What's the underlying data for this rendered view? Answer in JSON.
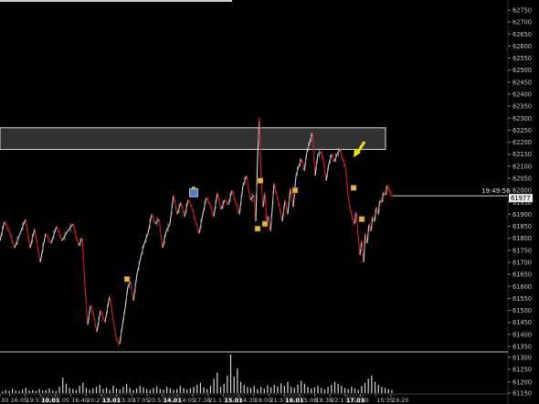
{
  "chart_data": {
    "type": "line",
    "price_axis": {
      "ticks": [
        62750,
        62700,
        62650,
        62600,
        62550,
        62500,
        62450,
        62400,
        62350,
        62300,
        62250,
        62200,
        62150,
        62100,
        62050,
        62000,
        61950,
        61900,
        61850,
        61800,
        61750,
        61700,
        61650,
        61600,
        61550,
        61500,
        61450,
        61400,
        61350
      ],
      "tick_labels": [
        "62750",
        "62700",
        "62650",
        "62600",
        "62550",
        "62500",
        "62450",
        "62400",
        "62350",
        "62300",
        "62250",
        "62200",
        "62150",
        "62100",
        "62050",
        "62000",
        "61950",
        "61900",
        "61850",
        "61800",
        "61750",
        "61700",
        "61650",
        "61600",
        "61550",
        "61500",
        "61450",
        "61400",
        "61350"
      ],
      "range": [
        61320,
        62780
      ]
    },
    "volume_axis": {
      "ticks": [
        61300,
        61250,
        61200,
        61150
      ],
      "tick_labels": [
        "61300",
        "61250",
        "61200",
        "61150"
      ]
    },
    "time_axis": {
      "labels": [
        "30",
        "16:05",
        "19:55",
        "10.01",
        "1:05",
        "16:40",
        "20:20",
        "13.01",
        "13:30",
        "17:05",
        "20:50",
        "14.01",
        "14:05",
        "17:38",
        "21:1",
        "15.01",
        "14:30",
        "18:00",
        "21:3",
        "16.01",
        "15:08",
        "18:38",
        "22:1",
        "17.01",
        "00",
        "15:35",
        "19:20"
      ],
      "highlighted": [
        "10.01",
        "13.01",
        "14.01",
        "15.01",
        "16.01",
        "17.01"
      ]
    },
    "series": [
      {
        "x": [
          0,
          5,
          10,
          16,
          22,
          28,
          33,
          38,
          44,
          50,
          56,
          62,
          68,
          74,
          80,
          86,
          90,
          93,
          96,
          99,
          102,
          106,
          110,
          115,
          120,
          124,
          128,
          131,
          134,
          137,
          140,
          143,
          146,
          150,
          154,
          158,
          162,
          166,
          170,
          174,
          178,
          182,
          186,
          190,
          194,
          198,
          202,
          206,
          210,
          214,
          218,
          222,
          226,
          230,
          234,
          238,
          242,
          246,
          250,
          254,
          258,
          262,
          266,
          270,
          274,
          278,
          280,
          282,
          284,
          286,
          288,
          290,
          292,
          294,
          296,
          298,
          300,
          303,
          306,
          309,
          312,
          315,
          318,
          321,
          324,
          327,
          330,
          333,
          336,
          339,
          342,
          345,
          348,
          351,
          354,
          357,
          360,
          363,
          366,
          369,
          372,
          375,
          378,
          381,
          384,
          386,
          388,
          390,
          392,
          394,
          396,
          398,
          400,
          402,
          404,
          406,
          408,
          410,
          412,
          414,
          416,
          418,
          420,
          422,
          424,
          426,
          428,
          430
        ],
        "y": [
          61790,
          61870,
          61830,
          61760,
          61820,
          61880,
          61760,
          61840,
          61700,
          61820,
          61780,
          61850,
          61790,
          61830,
          61860,
          61770,
          61800,
          61600,
          61440,
          61520,
          61490,
          61410,
          61500,
          61450,
          61560,
          61460,
          61370,
          61360,
          61440,
          61510,
          61600,
          61620,
          61540,
          61650,
          61720,
          61780,
          61820,
          61900,
          61860,
          61880,
          61760,
          61830,
          61860,
          61980,
          61900,
          61950,
          61890,
          61960,
          61930,
          61870,
          61820,
          61900,
          61970,
          61940,
          61890,
          61990,
          61920,
          61960,
          61940,
          62000,
          61950,
          61900,
          62020,
          62060,
          61960,
          61980,
          61870,
          62140,
          62300,
          62040,
          61930,
          61990,
          61860,
          61890,
          61830,
          61920,
          62030,
          61980,
          61930,
          61870,
          61960,
          61900,
          62010,
          61930,
          62060,
          62100,
          62130,
          62080,
          62160,
          62200,
          62240,
          62060,
          62150,
          62160,
          62130,
          62040,
          62110,
          62150,
          62120,
          62150,
          62170,
          62130,
          62100,
          61980,
          61910,
          61880,
          61860,
          61910,
          61810,
          61730,
          61790,
          61700,
          61820,
          61780,
          61860,
          61830,
          61890,
          61870,
          61930,
          61900,
          61960,
          61950,
          61990,
          61980,
          62020,
          62000,
          61980,
          61977
        ]
      }
    ],
    "volume": [
      3,
      6,
      4,
      8,
      5,
      4,
      7,
      10,
      5,
      6,
      4,
      8,
      5,
      6,
      9,
      5,
      4,
      12,
      30,
      18,
      10,
      8,
      6,
      14,
      20,
      10,
      6,
      9,
      12,
      16,
      8,
      10,
      6,
      14,
      9,
      7,
      12,
      18,
      10,
      6,
      9,
      14,
      11,
      8,
      6,
      10,
      13,
      8,
      7,
      12,
      9,
      6,
      8,
      14,
      10,
      7,
      9,
      12,
      16,
      20,
      11,
      8,
      14,
      28,
      40,
      12,
      18,
      34,
      75,
      32,
      48,
      22,
      16,
      12,
      10,
      14,
      8,
      12,
      9,
      15,
      11,
      16,
      13,
      19,
      14,
      22,
      12,
      10,
      16,
      24,
      18,
      12,
      9,
      11,
      14,
      10,
      7,
      12,
      16,
      22,
      18,
      14,
      10,
      8,
      12,
      9,
      6,
      14,
      20,
      28,
      34,
      22,
      16,
      12,
      10,
      8,
      6
    ],
    "markers": [
      {
        "x": 139,
        "y": 61630,
        "label": "s"
      },
      {
        "x": 212,
        "y": 61990,
        "label": "b"
      },
      {
        "x": 282,
        "y": 61840,
        "label": "s"
      },
      {
        "x": 285,
        "y": 62040,
        "label": "s"
      },
      {
        "x": 290,
        "y": 61860,
        "label": "s"
      },
      {
        "x": 323,
        "y": 62000,
        "label": "s"
      },
      {
        "x": 387,
        "y": 62010,
        "label": "s"
      },
      {
        "x": 396,
        "y": 61880,
        "label": "s"
      }
    ],
    "resistance_zone": [
      62170,
      62260
    ],
    "current_price_line": {
      "value": 61977,
      "price_label": "61977",
      "time_label": "19:49:56"
    },
    "arrow": {
      "color": "#f5e400",
      "direction": "down-left"
    },
    "colors": {
      "background": "#000000",
      "line_up": "#d9d9d9",
      "line_down": "#e02020",
      "volume": "#d8d8d8",
      "zone_fill": "#3a3a3a",
      "zone_border": "#dddddd",
      "axis_text": "#c8c8c8",
      "marker_fill": "#e8b24a",
      "marker_buy_fill": "#4a7fc0"
    }
  }
}
